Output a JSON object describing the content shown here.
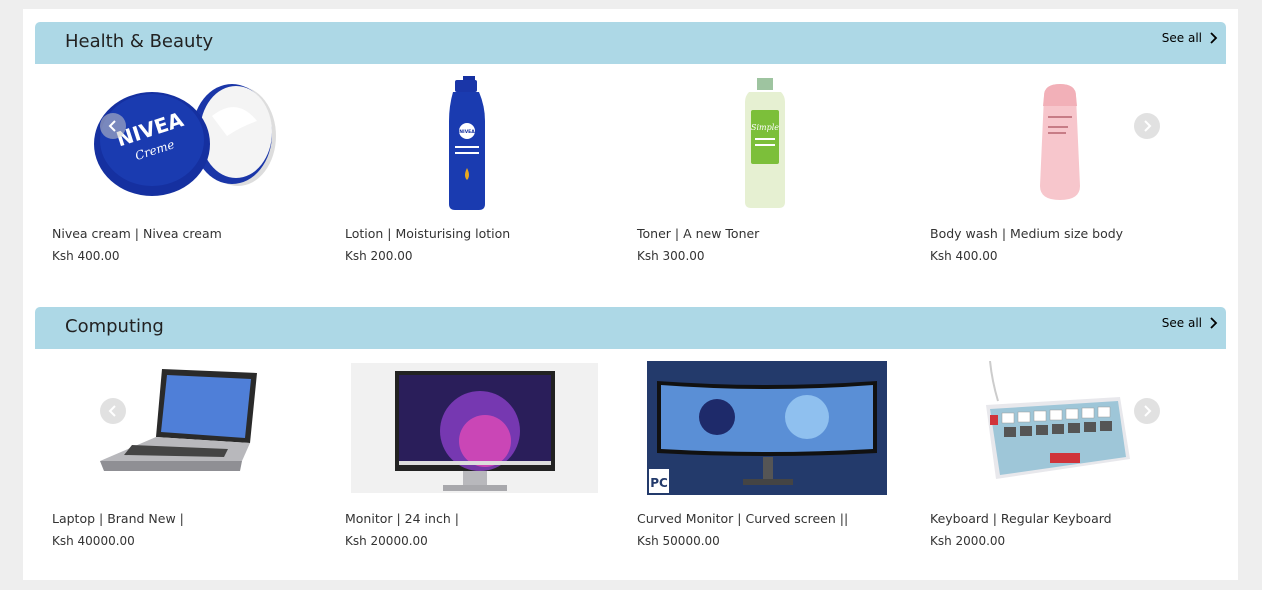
{
  "sections": [
    {
      "title": "Health & Beauty",
      "see_all": "See all",
      "products": [
        {
          "name": "Nivea cream | Nivea cream",
          "price": "Ksh 400.00",
          "image": "nivea-tin"
        },
        {
          "name": "Lotion | Moisturising lotion",
          "price": "Ksh 200.00",
          "image": "lotion-bottle"
        },
        {
          "name": "Toner | A new Toner",
          "price": "Ksh 300.00",
          "image": "toner-bottle"
        },
        {
          "name": "Body wash | Medium size body",
          "price": "Ksh 400.00",
          "image": "body-wash-bottle"
        }
      ]
    },
    {
      "title": "Computing",
      "see_all": "See all",
      "products": [
        {
          "name": "Laptop | Brand New |",
          "price": "Ksh 40000.00",
          "image": "laptop"
        },
        {
          "name": "Monitor | 24 inch |",
          "price": "Ksh 20000.00",
          "image": "monitor"
        },
        {
          "name": "Curved Monitor | Curved screen ||",
          "price": "Ksh 50000.00",
          "image": "curved-monitor"
        },
        {
          "name": "Keyboard | Regular Keyboard",
          "price": "Ksh 2000.00",
          "image": "keyboard"
        }
      ]
    }
  ],
  "image_labels": {
    "nivea_brand": "NIVEA",
    "nivea_sub": "Creme",
    "lotion_brand": "NIVEA",
    "toner_brand": "Simple",
    "monitor_watermark": "PC"
  },
  "colors": {
    "section_header_bg": "#add8e6",
    "page_bg": "#eeeeee",
    "panel_bg": "#ffffff",
    "nivea_blue": "#1530a0"
  },
  "icons": {
    "see_all": "chevron-right-icon",
    "prev": "chevron-left-icon",
    "next": "chevron-right-icon"
  }
}
